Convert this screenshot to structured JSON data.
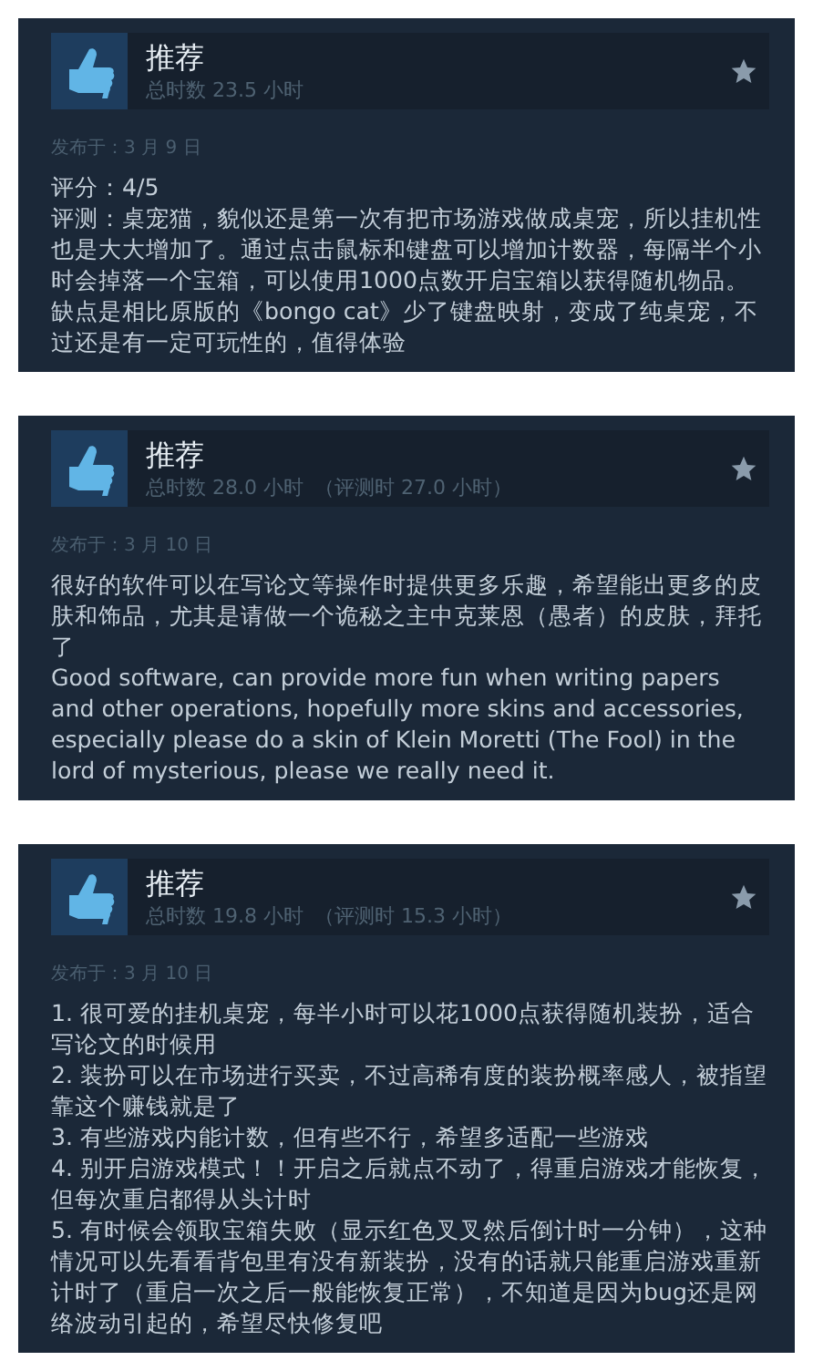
{
  "reviews": [
    {
      "verdict": "推荐",
      "hours": "总时数 23.5 小时",
      "posted": "发布于：3 月 9 日",
      "paragraphs": [
        "评分：4/5",
        "评测：桌宠猫，貌似还是第一次有把市场游戏做成桌宠，所以挂机性也是大大增加了。通过点击鼠标和键盘可以增加计数器，每隔半个小时会掉落一个宝箱，可以使用1000点数开启宝箱以获得随机物品。缺点是相比原版的《bongo cat》少了键盘映射，变成了纯桌宠，不过还是有一定可玩性的，值得体验"
      ]
    },
    {
      "verdict": "推荐",
      "hours": "总时数 28.0 小时",
      "review_hours": "（评测时 27.0 小时）",
      "posted": "发布于：3 月 10 日",
      "paragraphs": [
        "很好的软件可以在写论文等操作时提供更多乐趣，希望能出更多的皮肤和饰品，尤其是请做一个诡秘之主中克莱恩（愚者）的皮肤，拜托了",
        "Good software, can provide more fun when writing papers and other operations, hopefully more skins and accessories, especially please do a skin of Klein Moretti (The Fool) in the lord of mysterious, please we really need it."
      ]
    },
    {
      "verdict": "推荐",
      "hours": "总时数 19.8 小时",
      "review_hours": "（评测时 15.3 小时）",
      "posted": "发布于：3 月 10 日",
      "paragraphs": [
        "1. 很可爱的挂机桌宠，每半小时可以花1000点获得随机装扮，适合写论文的时候用",
        "2. 装扮可以在市场进行买卖，不过高稀有度的装扮概率感人，被指望靠这个赚钱就是了",
        "3. 有些游戏内能计数，但有些不行，希望多适配一些游戏",
        "4. 别开启游戏模式！！开启之后就点不动了，得重启游戏才能恢复，但每次重启都得从头计时",
        "5. 有时候会领取宝箱失败（显示红色叉叉然后倒计时一分钟），这种情况可以先看看背包里有没有新装扮，没有的话就只能重启游戏重新计时了（重启一次之后一般能恢复正常），不知道是因为bug还是网络波动引起的，希望尽快修复吧"
      ]
    }
  ]
}
